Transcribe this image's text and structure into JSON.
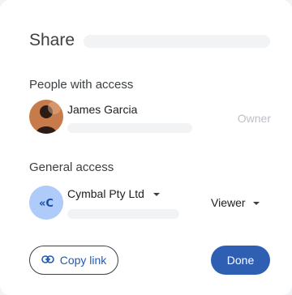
{
  "dialog": {
    "title": "Share"
  },
  "people_section": {
    "label": "People with access",
    "people": [
      {
        "name": "James Garcia",
        "role": "Owner"
      }
    ]
  },
  "general_access": {
    "label": "General access",
    "organization": "Cymbal Pty Ltd",
    "role": "Viewer"
  },
  "footer": {
    "copy_link_label": "Copy link",
    "done_label": "Done"
  },
  "colors": {
    "primary_button": "#2f5fb3",
    "link_text": "#1f5bb5",
    "org_avatar_bg": "#aecbfa",
    "org_avatar_fg": "#174ea6"
  },
  "icons": {
    "avatar": "person-avatar-icon",
    "org": "organization-icon",
    "link": "link-icon",
    "dropdown": "caret-down-icon"
  }
}
